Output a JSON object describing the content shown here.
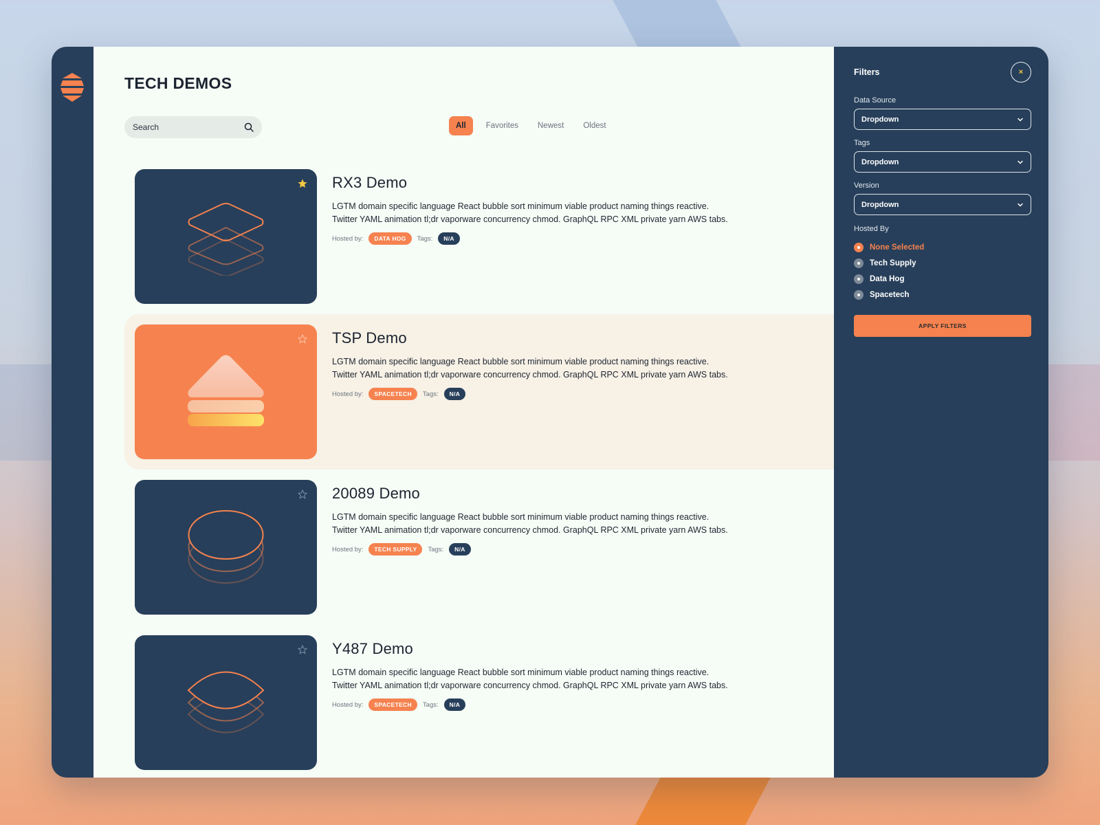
{
  "colors": {
    "navy": "#273f5a",
    "accent": "#f5824f",
    "main_bg": "#f6fcf6",
    "star_active": "#f5c842"
  },
  "page": {
    "title": "TECH DEMOS"
  },
  "search": {
    "placeholder": "Search"
  },
  "tabs": [
    {
      "label": "All",
      "active": true
    },
    {
      "label": "Favorites",
      "active": false
    },
    {
      "label": "Newest",
      "active": false
    },
    {
      "label": "Oldest",
      "active": false
    }
  ],
  "meta_labels": {
    "hosted_by": "Hosted by:",
    "tags": "Tags:"
  },
  "demos": [
    {
      "title": "RX3 Demo",
      "desc_line1": "LGTM domain specific language React bubble sort minimum viable product naming things reactive.",
      "desc_line2": "Twitter YAML animation tl;dr vaporware concurrency chmod. GraphQL RPC XML private yarn AWS tabs.",
      "host": "DATA HOG",
      "tag": "N/A",
      "favorite": true,
      "icon": "stack-diamond-icon"
    },
    {
      "title": "TSP Demo",
      "desc_line1": "LGTM domain specific language React bubble sort minimum viable product naming things reactive.",
      "desc_line2": "Twitter YAML animation tl;dr vaporware concurrency chmod. GraphQL RPC XML private yarn AWS tabs.",
      "host": "SPACETECH",
      "tag": "N/A",
      "favorite": false,
      "icon": "stack-triangle-icon"
    },
    {
      "title": "20089 Demo",
      "desc_line1": "LGTM domain specific language React bubble sort minimum viable product naming things reactive.",
      "desc_line2": "Twitter YAML animation tl;dr vaporware concurrency chmod. GraphQL RPC XML private yarn AWS tabs.",
      "host": "TECH SUPPLY",
      "tag": "N/A",
      "favorite": false,
      "icon": "stack-ellipse-icon"
    },
    {
      "title": "Y487 Demo",
      "desc_line1": "LGTM domain specific language React bubble sort minimum viable product naming things reactive.",
      "desc_line2": "Twitter YAML animation tl;dr vaporware concurrency chmod. GraphQL RPC XML private yarn AWS tabs.",
      "host": "SPACETECH",
      "tag": "N/A",
      "favorite": false,
      "icon": "stack-lens-icon"
    }
  ],
  "filters": {
    "title": "Filters",
    "close_glyph": "×",
    "data_source": {
      "label": "Data Source",
      "value": "Dropdown"
    },
    "tags": {
      "label": "Tags",
      "value": "Dropdown"
    },
    "version": {
      "label": "Version",
      "value": "Dropdown"
    },
    "hosted_by": {
      "label": "Hosted By",
      "options": [
        {
          "label": "None Selected",
          "selected": true
        },
        {
          "label": "Tech Supply",
          "selected": false
        },
        {
          "label": "Data Hog",
          "selected": false
        },
        {
          "label": "Spacetech",
          "selected": false
        }
      ]
    },
    "apply_label": "APPLY FILTERS"
  }
}
